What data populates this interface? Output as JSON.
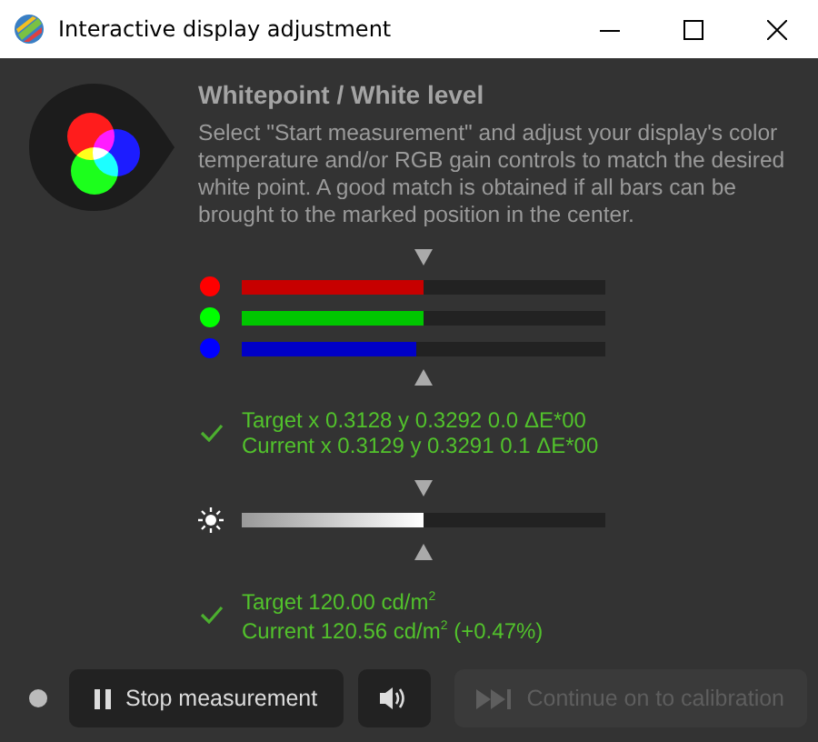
{
  "window": {
    "title": "Interactive display adjustment"
  },
  "heading": "Whitepoint / White level",
  "description": "Select \"Start measurement\" and adjust your display's color temperature and/or RGB gain controls to match the desired white point. A good match is obtained if all bars can be brought to the marked position in the center.",
  "channels": [
    {
      "color": "#ff0000",
      "level": 0.5
    },
    {
      "color": "#00ff00",
      "level": 0.5
    },
    {
      "color": "#0000ff",
      "level": 0.48
    }
  ],
  "whitepoint_status": {
    "ok": true,
    "lines": [
      "Target x 0.3128 y 0.3292 0.0 ΔE*00",
      "Current x 0.3129 y 0.3291 0.1 ΔE*00"
    ]
  },
  "luminance": {
    "level": 0.5
  },
  "luminance_status": {
    "ok": true,
    "lines": [
      "Target 120.00 cd/m$^{2}$",
      "Current 120.56 cd/m$^{2}$ (+0.47%)"
    ]
  },
  "buttons": [
    {
      "kind": "stop",
      "label": "Stop measurement",
      "disabled": false
    },
    {
      "kind": "sound",
      "disabled": false
    },
    {
      "kind": "continue",
      "label": "Continue on to calibration",
      "disabled": true
    }
  ]
}
